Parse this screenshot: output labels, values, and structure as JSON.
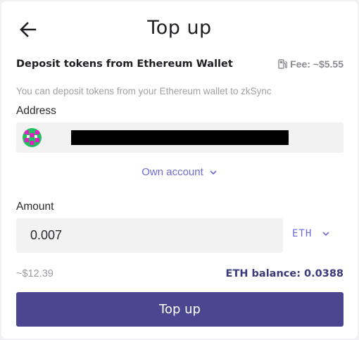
{
  "header": {
    "back_icon": "arrow-left-icon",
    "title": "Top up"
  },
  "deposit": {
    "heading": "Deposit tokens from Ethereum Wallet",
    "fee_icon": "gas-pump-icon",
    "fee_text": "Fee: ~$5.55",
    "hint": "You can deposit tokens from your Ethereum wallet to zkSync"
  },
  "address": {
    "label": "Address",
    "avatar_icon": "identicon-avatar",
    "value_redacted": true,
    "account_select": "Own account",
    "accent_color": "#6e6ad6"
  },
  "amount": {
    "label": "Amount",
    "value": "0.007",
    "token": "ETH",
    "usd_estimate": "~$12.39",
    "balance_text": "ETH balance: 0.0388"
  },
  "actions": {
    "submit_label": "Top up",
    "submit_color": "#4a4790"
  }
}
